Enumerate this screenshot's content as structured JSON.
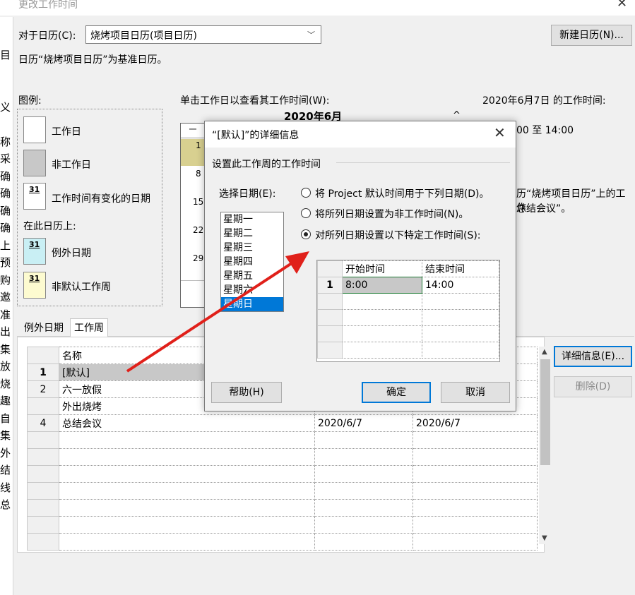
{
  "window": {
    "title": "更改工作时间",
    "close_glyph": "✕"
  },
  "left_strip": {
    "chars": [
      "目",
      "",
      "",
      "义",
      "",
      "称",
      "采",
      "确",
      "确",
      "确",
      "确",
      "上",
      "预",
      "购",
      "邀",
      "准",
      "出",
      "集",
      "放",
      "烧",
      "趣",
      "自",
      "集",
      "外",
      "结",
      "线",
      "总"
    ]
  },
  "calendar_for": {
    "label": "对于日历(C):",
    "value": "烧烤项目日历(项目日历)"
  },
  "new_calendar_button": "新建日历(N)...",
  "base_calendar_note": "日历“烧烤项目日历”为基准日历。",
  "legend": {
    "title": "图例:",
    "working": "工作日",
    "nonworking": "非工作日",
    "changed": "工作时间有变化的日期",
    "changed_num": "31",
    "on_this_calendar": "在此日历上:",
    "exception": "例外日期",
    "exception_num": "31",
    "nondefault": "非默认工作周",
    "nondefault_num": "31"
  },
  "calendar_view": {
    "prompt": "单击工作日以查看其工作时间(W):",
    "month": "2020年6月",
    "dash": "一",
    "week_numbers": [
      "1",
      "8",
      "15",
      "22",
      "29"
    ]
  },
  "right_info": {
    "heading": "2020年6月7日 的工作时间:",
    "caret": "^",
    "time_range": "00 至 14:00",
    "based_on_1": "历“烧烤项目日历”上的工作",
    "based_on_2": "总结会议”。"
  },
  "tabs": {
    "exceptions": "例外日期",
    "work_weeks": "工作周"
  },
  "table": {
    "header_name": "名称",
    "rows": [
      {
        "num": "1",
        "name": "[默认]",
        "start": "",
        "end": ""
      },
      {
        "num": "2",
        "name": "六一放假",
        "start": "",
        "end": ""
      },
      {
        "num": "",
        "name": "外出烧烤",
        "start": "",
        "end": ""
      },
      {
        "num": "4",
        "name": "总结会议",
        "start": "2020/6/7",
        "end": "2020/6/7"
      }
    ]
  },
  "details_button": "详细信息(E)...",
  "delete_button": "删除(D)",
  "dialog": {
    "title": "“[默认]”的详细信息",
    "close_glyph": "✕",
    "group_title": "设置此工作周的工作时间",
    "select_days_label": "选择日期(E):",
    "days": [
      "星期一",
      "星期二",
      "星期三",
      "星期四",
      "星期五",
      "星期六",
      "星期日"
    ],
    "selected_day": "星期日",
    "options": [
      {
        "label": "将 Project 默认时间用于下列日期(D)。",
        "checked": false
      },
      {
        "label": "将所列日期设置为非工作时间(N)。",
        "checked": false
      },
      {
        "label": "对所列日期设置以下特定工作时间(S):",
        "checked": true
      }
    ],
    "time_table": {
      "col_start": "开始时间",
      "col_end": "结束时间",
      "row1_num": "1",
      "row1_start": "8:00",
      "row1_end": "14:00"
    },
    "help_button": "帮助(H)",
    "ok_button": "确定",
    "cancel_button": "取消"
  },
  "colors": {
    "nonworking": "#c8c8c8",
    "exception": "#c9eff4",
    "nondefault": "#fdfbd0",
    "highlight_cell": "#c8c8c8",
    "arrow": "#e0201a",
    "accent": "#0078d7"
  }
}
